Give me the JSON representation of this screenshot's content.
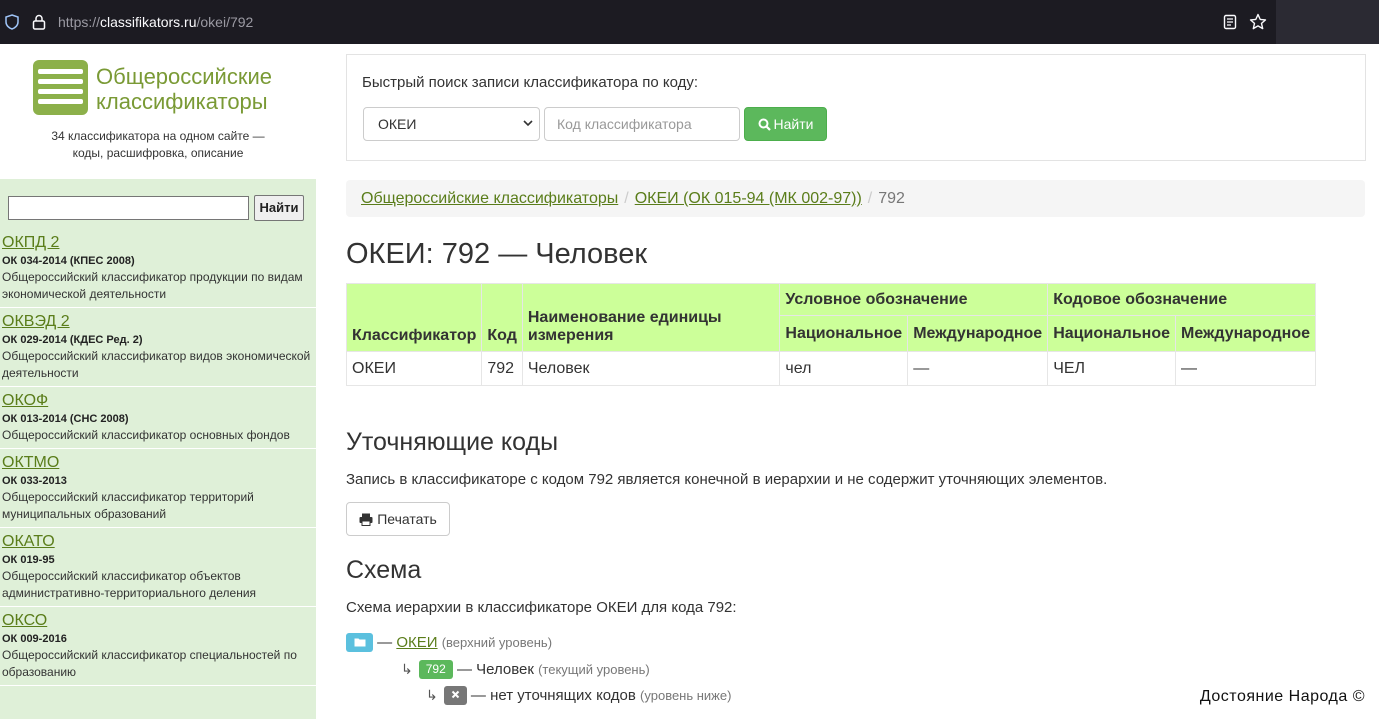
{
  "browser": {
    "url_prefix": "https://",
    "url_host": "classifikators.ru",
    "url_path": "/okei/792"
  },
  "site": {
    "title": "Общероссийские классификаторы",
    "tagline": "34 классификатора на одном сайте — коды, расшифровка, описание"
  },
  "sidebar": {
    "search_button": "Найти",
    "classifiers": [
      {
        "name": "ОКПД 2",
        "std": "ОК 034-2014 (КПЕС 2008)",
        "desc": "Общероссийский классификатор продукции по видам экономической деятельности"
      },
      {
        "name": "ОКВЭД 2",
        "std": "ОК 029-2014 (КДЕС Ред. 2)",
        "desc": "Общероссийский классификатор видов экономической деятельности"
      },
      {
        "name": "ОКОФ",
        "std": "ОК 013-2014 (СНС 2008)",
        "desc": "Общероссийский классификатор основных фондов"
      },
      {
        "name": "ОКТМО",
        "std": "ОК 033-2013",
        "desc": "Общероссийский классификатор территорий муниципальных образований"
      },
      {
        "name": "ОКАТО",
        "std": "ОК 019-95",
        "desc": "Общероссийский классификатор объектов административно-территориального деления"
      },
      {
        "name": "ОКСО",
        "std": "ОК 009-2016",
        "desc": "Общероссийский классификатор специальностей по образованию"
      }
    ]
  },
  "quick_search": {
    "label": "Быстрый поиск записи классификатора по коду:",
    "selected": "ОКЕИ",
    "placeholder": "Код классификатора",
    "button": "Найти"
  },
  "breadcrumb": {
    "home": "Общероссийские классификаторы",
    "section": "ОКЕИ (ОК 015-94 (МК 002-97))",
    "current": "792"
  },
  "page": {
    "title": "ОКЕИ: 792 — Человек"
  },
  "table": {
    "group_conditional": "Условное обозначение",
    "group_code": "Кодовое обозначение",
    "headers": [
      "Классификатор",
      "Код",
      "Наименование единицы измерения",
      "Национальное",
      "Международное",
      "Национальное",
      "Международное"
    ],
    "row": [
      "ОКЕИ",
      "792",
      "Человек",
      "чел",
      "—",
      "ЧЕЛ",
      "—"
    ]
  },
  "refining": {
    "title": "Уточняющие коды",
    "text": "Запись в классификаторе с кодом 792 является конечной в иерархии и не содержит уточняющих элементов.",
    "print_button": "Печатать"
  },
  "scheme": {
    "title": "Схема",
    "text": "Схема иерархии в классификаторе ОКЕИ для кода 792:",
    "level1_link": "ОКЕИ",
    "level1_note": "(верхний уровень)",
    "level2_badge": "792",
    "level2_text": "— Человек",
    "level2_note": "(текущий уровень)",
    "level3_text": "— нет уточнящих кодов",
    "level3_note": "(уровень ниже)",
    "dash": "—"
  },
  "watermark": "Достояние Народа ©"
}
